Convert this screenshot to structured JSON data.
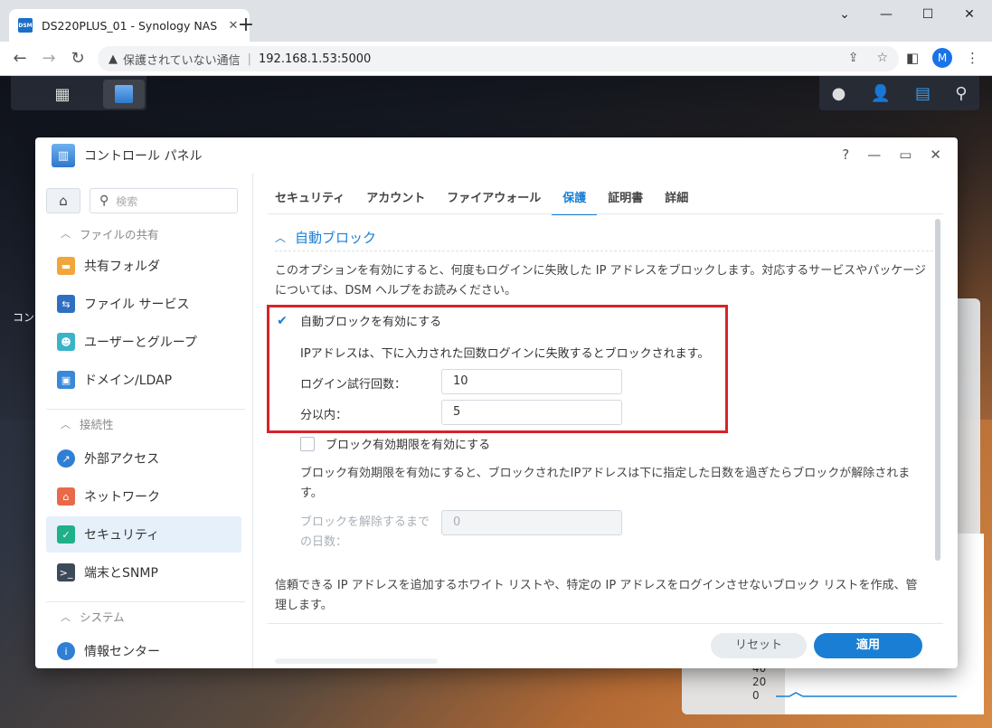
{
  "browser": {
    "tab_title": "DS220PLUS_01 - Synology NAS",
    "favicon_text": "DSM",
    "insecure_label": "保護されていない通信",
    "url": "192.168.1.53:5000",
    "profile_initial": "M"
  },
  "desktop": {
    "side_text": "コン",
    "chart_labels": [
      "40",
      "20",
      "0"
    ]
  },
  "window": {
    "title": "コントロール パネル",
    "help": "?",
    "minimize": "—",
    "maximize": "▭",
    "close": "✕"
  },
  "sidebar": {
    "search_placeholder": "検索",
    "sections": [
      {
        "label": "ファイルの共有"
      },
      {
        "label": "接続性"
      },
      {
        "label": "システム"
      }
    ],
    "items": [
      {
        "label": "共有フォルダ",
        "icon": "folder-icon"
      },
      {
        "label": "ファイル サービス",
        "icon": "file-services-icon"
      },
      {
        "label": "ユーザーとグループ",
        "icon": "users-icon"
      },
      {
        "label": "ドメイン/LDAP",
        "icon": "domain-icon"
      },
      {
        "label": "外部アクセス",
        "icon": "external-access-icon"
      },
      {
        "label": "ネットワーク",
        "icon": "network-icon"
      },
      {
        "label": "セキュリティ",
        "icon": "security-shield-icon"
      },
      {
        "label": "端末とSNMP",
        "icon": "terminal-icon"
      },
      {
        "label": "情報センター",
        "icon": "info-icon"
      }
    ]
  },
  "tabs": [
    "セキュリティ",
    "アカウント",
    "ファイアウォール",
    "保護",
    "証明書",
    "詳細"
  ],
  "active_tab": "保護",
  "autoblock": {
    "section_title": "自動ブロック",
    "description": "このオプションを有効にすると、何度もログインに失敗した IP アドレスをブロックします。対応するサービスやパッケージについては、DSM ヘルプをお読みください。",
    "enable_label": "自動ブロックを有効にする",
    "enable_checked": true,
    "info": "IPアドレスは、下に入力された回数ログインに失敗するとブロックされます。",
    "attempts_label": "ログイン試行回数：",
    "attempts_value": "10",
    "within_label": "分以内：",
    "within_value": "5",
    "expiry_label": "ブロック有効期限を有効にする",
    "expiry_checked": false,
    "expiry_desc": "ブロック有効期限を有効にすると、ブロックされたIPアドレスは下に指定した日数を過ぎたらブロックが解除されます。",
    "days_label": "ブロックを解除するまでの日数：",
    "days_value": "0",
    "allowlist_desc": "信頼できる IP アドレスを追加するホワイト リストや、特定の IP アドレスをログインさせないブロック リストを作成、管理します。"
  },
  "footer": {
    "reset": "リセット",
    "apply": "適用"
  },
  "colors": {
    "accent": "#1a7fd4",
    "highlight": "#d8232a"
  }
}
